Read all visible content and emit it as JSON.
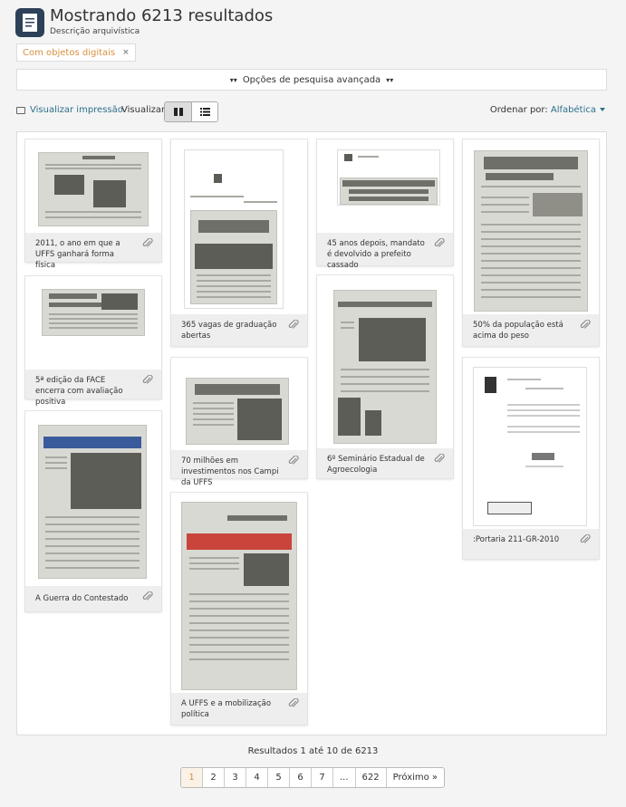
{
  "header": {
    "title": "Mostrando 6213 resultados",
    "subtitle": "Descrição arquivística",
    "icon": "document-icon"
  },
  "facet": {
    "label": "Com objetos digitais",
    "remove": "×"
  },
  "advanced_search": {
    "label": "Opções de pesquisa avançada"
  },
  "toolbar": {
    "print_label": "Visualizar impressão",
    "view_label": "Visualizar:",
    "view_modes": [
      "card-view",
      "table-view"
    ],
    "view_selected": "card-view",
    "sort_label": "Ordenar por:",
    "sort_value": "Alfabética"
  },
  "results": [
    {
      "caption": "2011, o ano em que a UFFS ganhará forma física"
    },
    {
      "caption": "5ª edição da FACE encerra com avaliação positiva"
    },
    {
      "caption": "A Guerra do Contestado"
    },
    {
      "caption": "365 vagas de graduação abertas"
    },
    {
      "caption": "70 milhões em investimentos nos Campi da UFFS"
    },
    {
      "caption": "A UFFS e a mobilização política"
    },
    {
      "caption": "45 anos depois, mandato é devolvido a prefeito cassado"
    },
    {
      "caption": "6º Seminário Estadual de Agroecologia"
    },
    {
      "caption": "50% da população está acima do peso"
    },
    {
      "caption": ":Portaria 211-GR-2010"
    }
  ],
  "summary": "Resultados 1 até 10 de 6213",
  "pagination": {
    "pages": [
      "1",
      "2",
      "3",
      "4",
      "5",
      "6",
      "7",
      "...",
      "622"
    ],
    "current": "1",
    "next": "Próximo »"
  },
  "colors": {
    "accent": "#d8903c",
    "link": "#2b6f8a",
    "header_icon_bg": "#2d4159"
  }
}
